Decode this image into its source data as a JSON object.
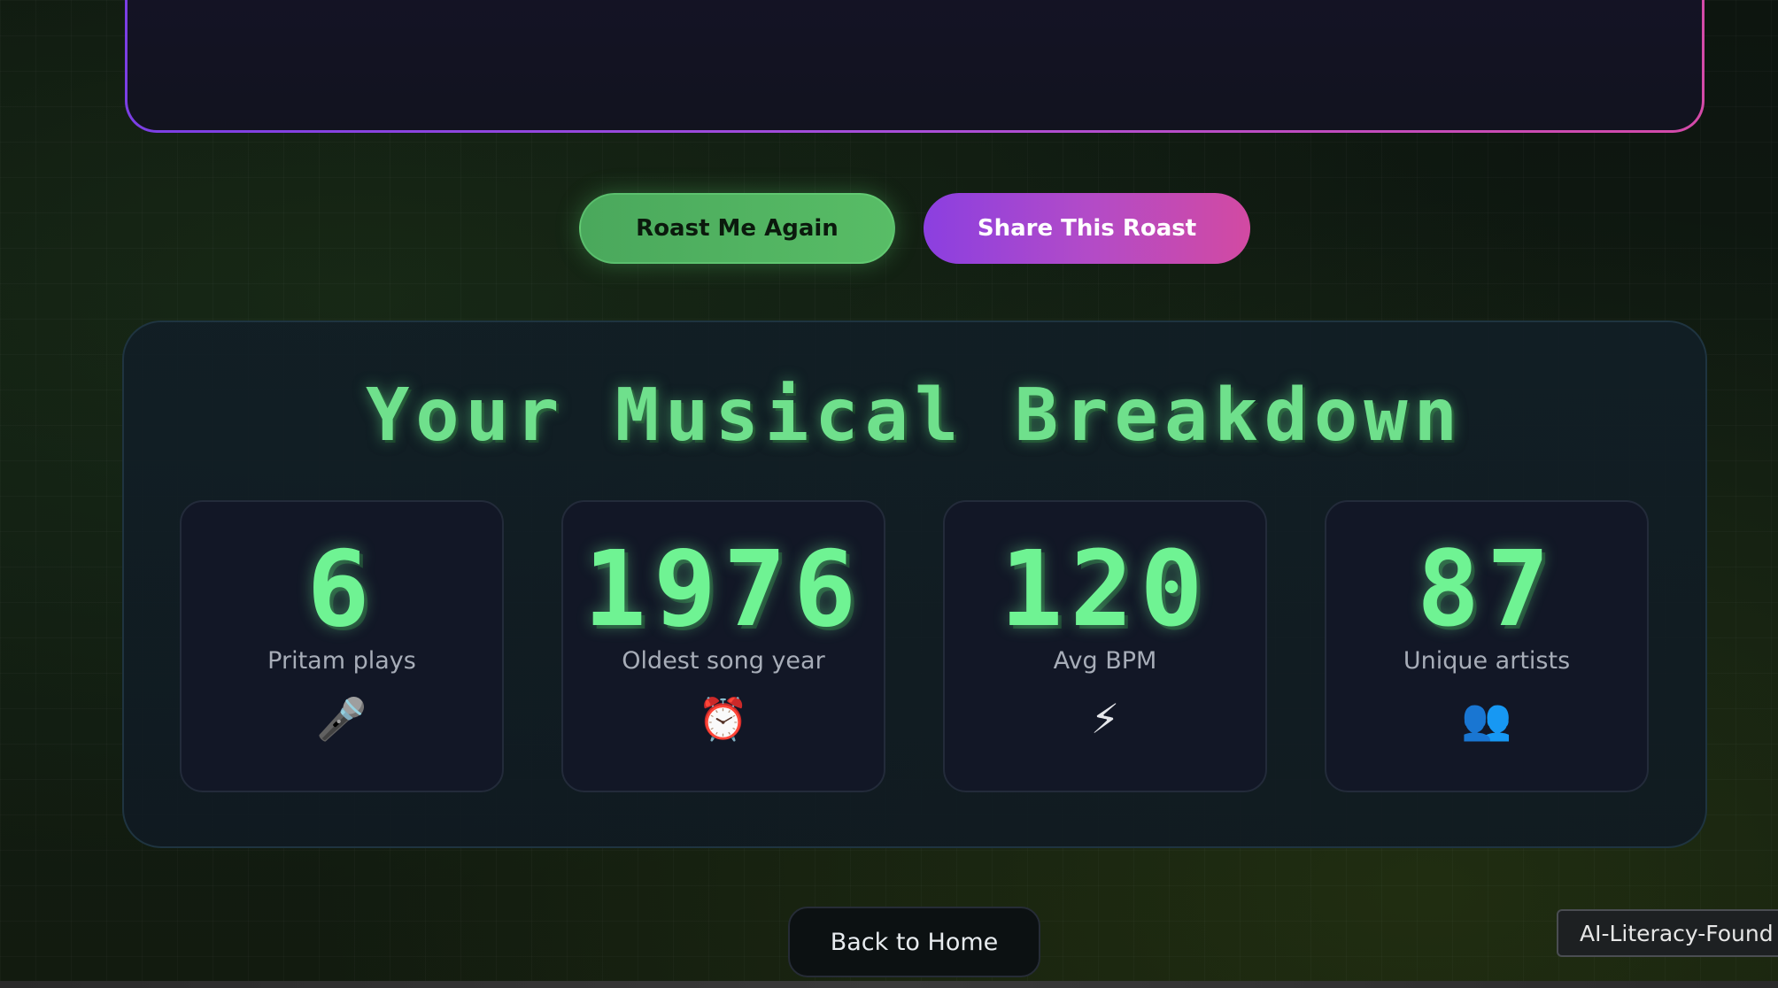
{
  "actions": {
    "roast_again_label": "Roast Me Again",
    "share_label": "Share This Roast"
  },
  "breakdown": {
    "title": "Your Musical Breakdown",
    "stats": [
      {
        "value": "6",
        "label": "Pritam plays",
        "icon": "microphone-icon",
        "glyph": "🎤"
      },
      {
        "value": "1976",
        "label": "Oldest song year",
        "icon": "alarm-clock-icon",
        "glyph": "⏰"
      },
      {
        "value": "120",
        "label": "Avg BPM",
        "icon": "lightning-icon",
        "glyph": "⚡"
      },
      {
        "value": "87",
        "label": "Unique artists",
        "icon": "people-icon",
        "glyph": "👥"
      }
    ]
  },
  "nav": {
    "back_home_label": "Back to Home"
  },
  "badge": {
    "text": "AI-Literacy-Found"
  },
  "colors": {
    "accent_green": "#6ff393",
    "accent_purple": "#8b3fe0",
    "accent_pink": "#d24aa2"
  }
}
